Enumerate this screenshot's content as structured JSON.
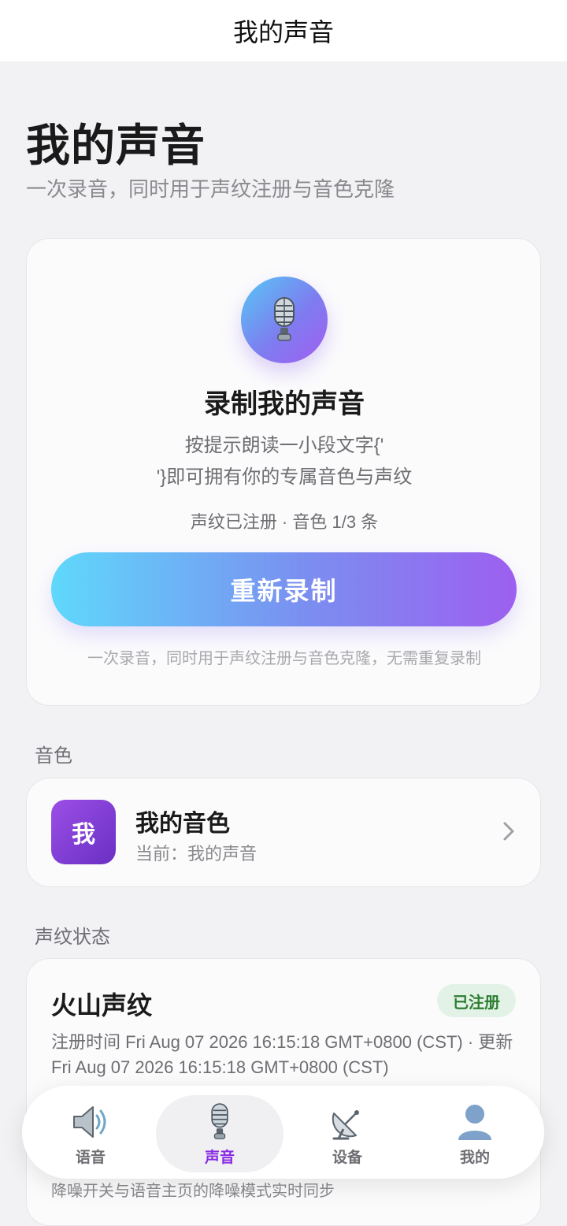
{
  "topbar": {
    "title": "我的声音"
  },
  "header": {
    "title": "我的声音",
    "subtitle": "一次录音，同时用于声纹注册与音色克隆"
  },
  "record": {
    "icon": "microphone-icon",
    "title": "录制我的声音",
    "desc_line1": "按提示朗读一小段文字{'",
    "desc_line2": "'}即可拥有你的专属音色与声纹",
    "status": "声纹已注册 · 音色 1/3 条",
    "button_label": "重新录制",
    "hint": "一次录音，同时用于声纹注册与音色克隆，无需重复录制",
    "colors": {
      "gradient_start": "#5fd8fb",
      "gradient_end": "#9d5ff0"
    }
  },
  "timbre": {
    "section_label": "音色",
    "avatar_text": "我",
    "name": "我的音色",
    "current": "当前：我的声音",
    "icon": "chevron-right-icon"
  },
  "voiceprint": {
    "section_label": "声纹状态",
    "title": "火山声纹",
    "badge": "已注册",
    "meta": "注册时间 Fri Aug 07 2026 16:15:18 GMT+0800 (CST) · 更新 Fri Aug 07 2026 16:15:18 GMT+0800 (CST)",
    "bottom_note": "降噪开关与语音主页的降噪模式实时同步",
    "colors": {
      "badge_bg": "#e3f2e6",
      "badge_text": "#2e7d32"
    }
  },
  "tabs": [
    {
      "label": "语音",
      "icon": "speaker-icon",
      "active": false
    },
    {
      "label": "声音",
      "icon": "microphone-icon",
      "active": true
    },
    {
      "label": "设备",
      "icon": "satellite-dish-icon",
      "active": false
    },
    {
      "label": "我的",
      "icon": "user-icon",
      "active": false
    }
  ],
  "accent_color": "#8a2be2"
}
